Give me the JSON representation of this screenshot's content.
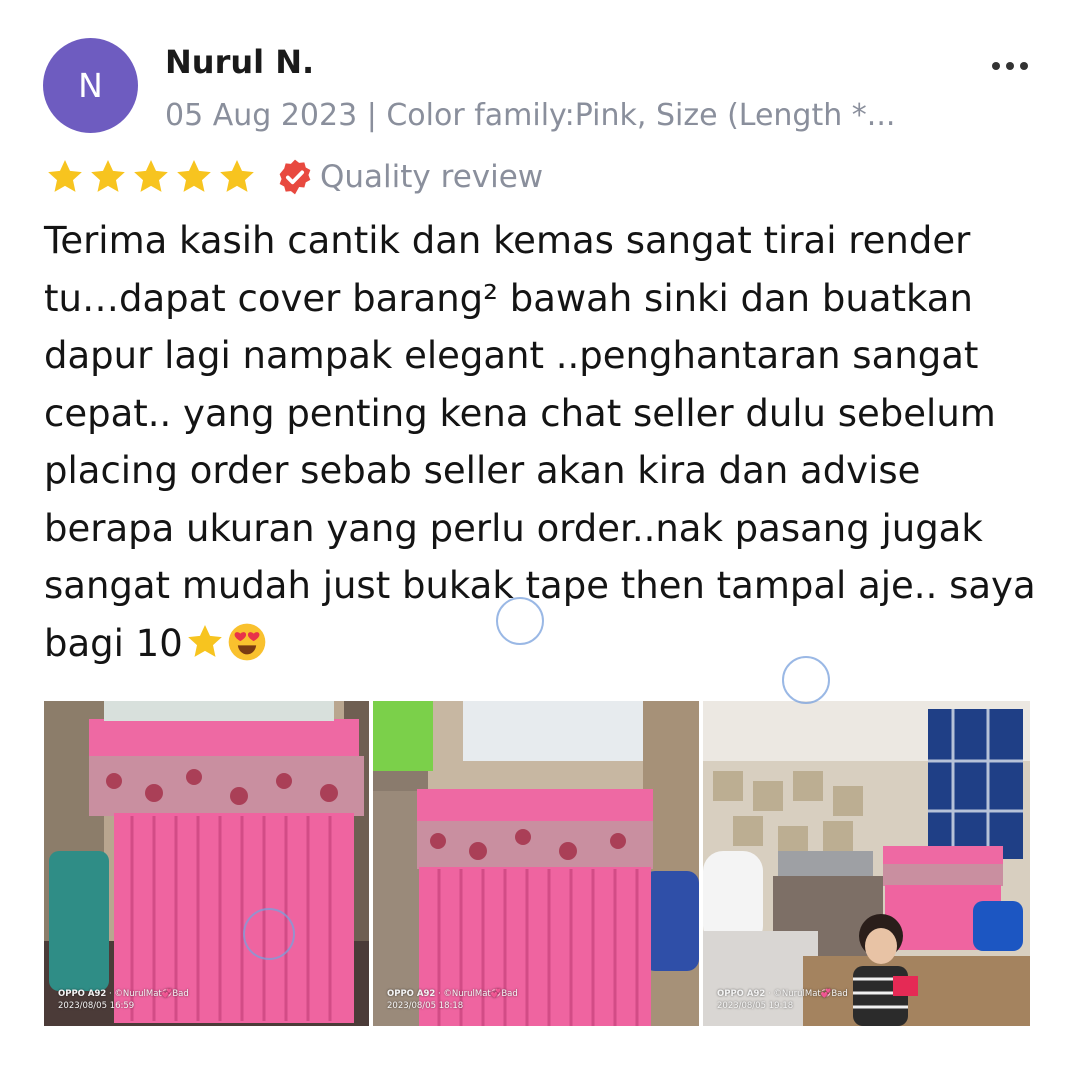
{
  "reviewer": {
    "initial": "N",
    "name": "Nurul N.",
    "meta": "05 Aug 2023 | Color family:Pink, Size (Length *..."
  },
  "rating": {
    "stars": 5,
    "max": 5,
    "badge_label": "Quality review"
  },
  "review_text": "Terima kasih cantik dan kemas sangat tirai render tu…dapat cover barang² bawah sinki dan buatkan dapur lagi nampak elegant ..penghantaran sangat cepat.. yang penting kena chat seller dulu sebelum placing order sebab seller akan kira dan advise berapa ukuran yang perlu order..nak pasang jugak sangat mudah just bukak tape then tampal aje.. saya bagi 10",
  "photos": [
    {
      "device": "OPPO A92",
      "owner": "©NurulMat💞Bad",
      "timestamp": "2023/08/05 16:59"
    },
    {
      "device": "OPPO A92",
      "owner": "©NurulMat💞Bad",
      "timestamp": "2023/08/05 18:18"
    },
    {
      "device": "OPPO A92",
      "owner": "©NurulMat💞Bad",
      "timestamp": "2023/08/05 19:18"
    }
  ],
  "colors": {
    "avatar": "#6e5cc0",
    "star": "#f7c41f",
    "badge": "#e8493f",
    "secondary_text": "#8a8f9c"
  },
  "icons": {
    "star": "star-icon",
    "badge": "verified-badge-icon",
    "more": "more-options-icon"
  }
}
